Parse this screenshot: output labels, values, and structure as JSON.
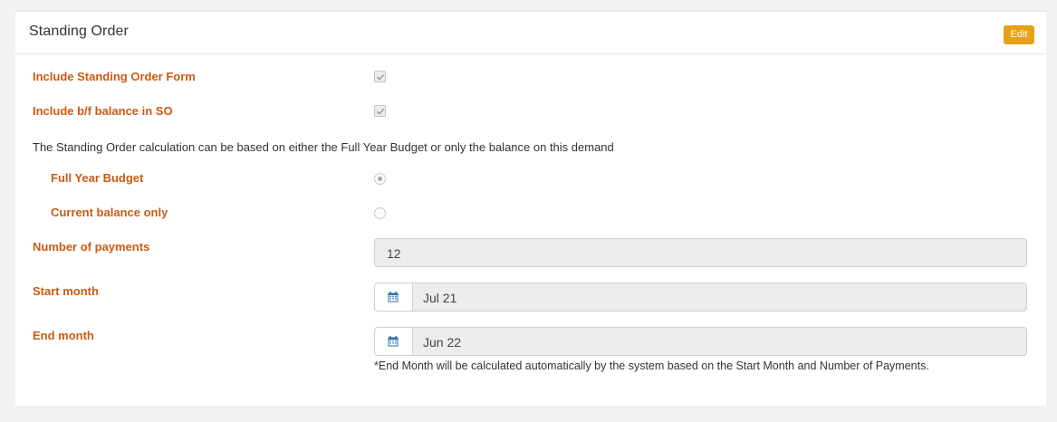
{
  "panel": {
    "title": "Standing Order",
    "edit_label": "Edit"
  },
  "form": {
    "include_form": {
      "label": "Include Standing Order Form",
      "checked": true
    },
    "include_bf": {
      "label": "Include b/f balance in SO",
      "checked": true
    },
    "description": "The Standing Order calculation can be based on either the Full Year Budget or only the balance on this demand",
    "basis_options": [
      {
        "label": "Full Year Budget",
        "selected": true
      },
      {
        "label": "Current balance only",
        "selected": false
      }
    ],
    "num_payments": {
      "label": "Number of payments",
      "value": "12"
    },
    "start_month": {
      "label": "Start month",
      "value": "Jul 21",
      "icon": "calendar-icon"
    },
    "end_month": {
      "label": "End month",
      "value": "Jun 22",
      "icon": "calendar-icon"
    },
    "end_month_note": "*End Month will be calculated automatically by the system based on the Start Month and Number of Payments."
  },
  "colors": {
    "label": "#cc5a12",
    "edit_button": "#e8a114",
    "calendar_icon": "#2a6fb0"
  }
}
